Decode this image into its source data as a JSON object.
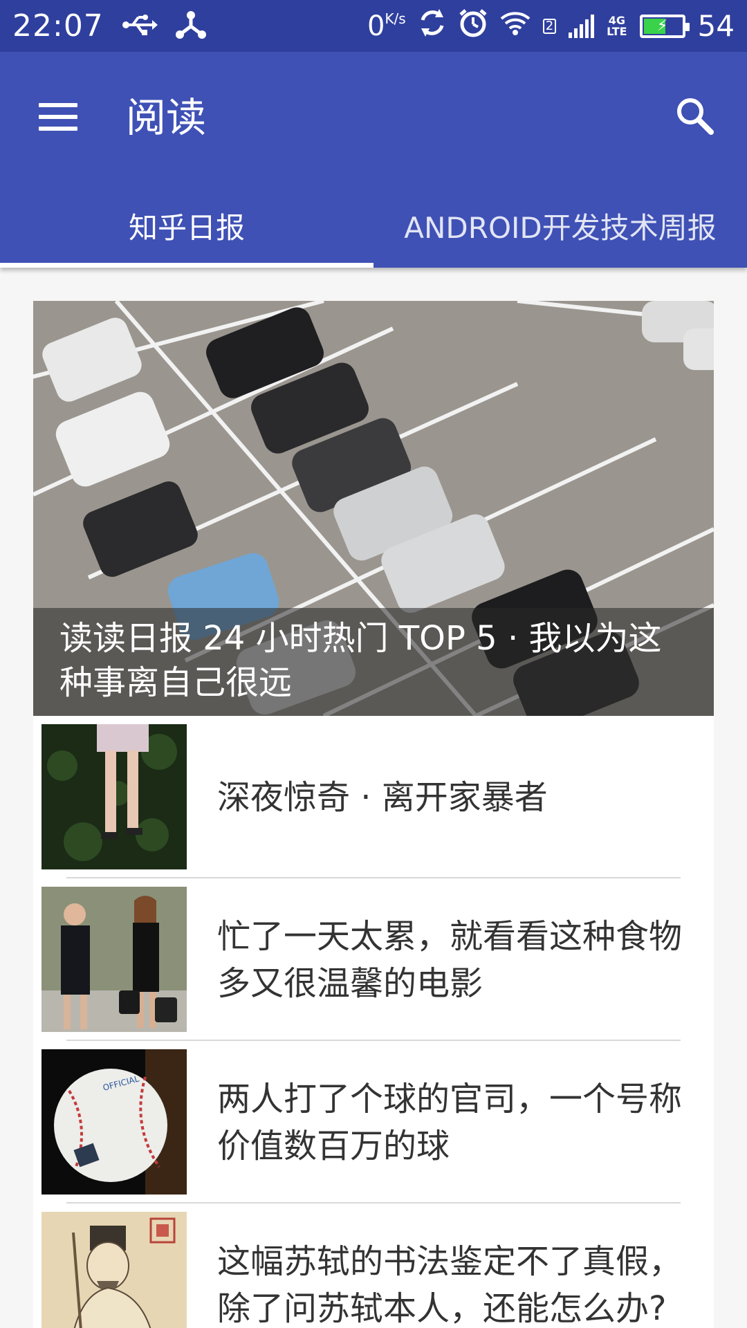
{
  "status_bar": {
    "time": "22:07",
    "speed_value": "0",
    "speed_unit": "K/s",
    "sim_slot": "2",
    "network_type": "4G",
    "network_sub": "LTE",
    "battery_level": "54",
    "icons": [
      "usb-icon",
      "share-icon",
      "sync-icon",
      "alarm-icon",
      "wifi-icon",
      "signal-icon",
      "battery-icon"
    ]
  },
  "app_bar": {
    "title": "阅读",
    "menu_icon": "hamburger-menu-icon",
    "search_icon": "search-icon"
  },
  "tabs": [
    {
      "label": "知乎日报",
      "active": true
    },
    {
      "label": "ANDROID开发技术周报",
      "active": false
    }
  ],
  "hero": {
    "caption": "读读日报 24 小时热门 TOP 5 · 我以为这种事离自己很远"
  },
  "articles": [
    {
      "title": "深夜惊奇 · 离开家暴者"
    },
    {
      "title": "忙了一天太累，就看看这种食物多又很温馨的电影"
    },
    {
      "title": "两人打了个球的官司，一个号称价值数百万的球"
    },
    {
      "title": "这幅苏轼的书法鉴定不了真假，除了问苏轼本人，还能怎么办?"
    }
  ],
  "colors": {
    "status_bar": "#2f3f9e",
    "app_bar": "#3f51b5",
    "background": "#f6f6f6",
    "battery_fill": "#3ad24a"
  }
}
